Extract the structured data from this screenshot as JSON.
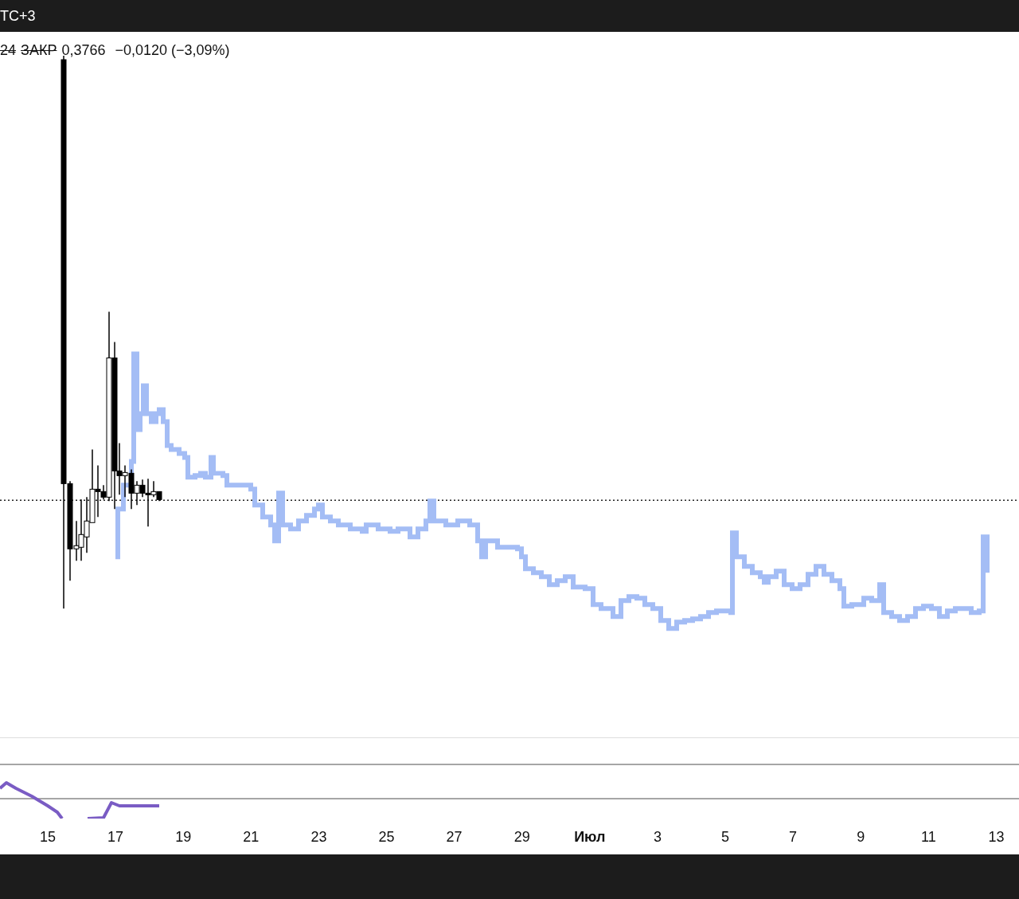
{
  "top_bar": {
    "timezone": "TC+3"
  },
  "legend": {
    "prefix": "24",
    "close_label": "ЗАКР",
    "close_value": "0,3766",
    "change": "−0,0120 (−3,09%)"
  },
  "time_axis": [
    {
      "text": "15",
      "kind": "day"
    },
    {
      "text": "17",
      "kind": "day"
    },
    {
      "text": "19",
      "kind": "day"
    },
    {
      "text": "21",
      "kind": "day"
    },
    {
      "text": "23",
      "kind": "day"
    },
    {
      "text": "25",
      "kind": "day"
    },
    {
      "text": "27",
      "kind": "day"
    },
    {
      "text": "29",
      "kind": "day"
    },
    {
      "text": "Июл",
      "kind": "month"
    },
    {
      "text": "3",
      "kind": "day"
    },
    {
      "text": "5",
      "kind": "day"
    },
    {
      "text": "7",
      "kind": "day"
    },
    {
      "text": "9",
      "kind": "day"
    },
    {
      "text": "11",
      "kind": "day"
    },
    {
      "text": "13",
      "kind": "day"
    }
  ]
}
